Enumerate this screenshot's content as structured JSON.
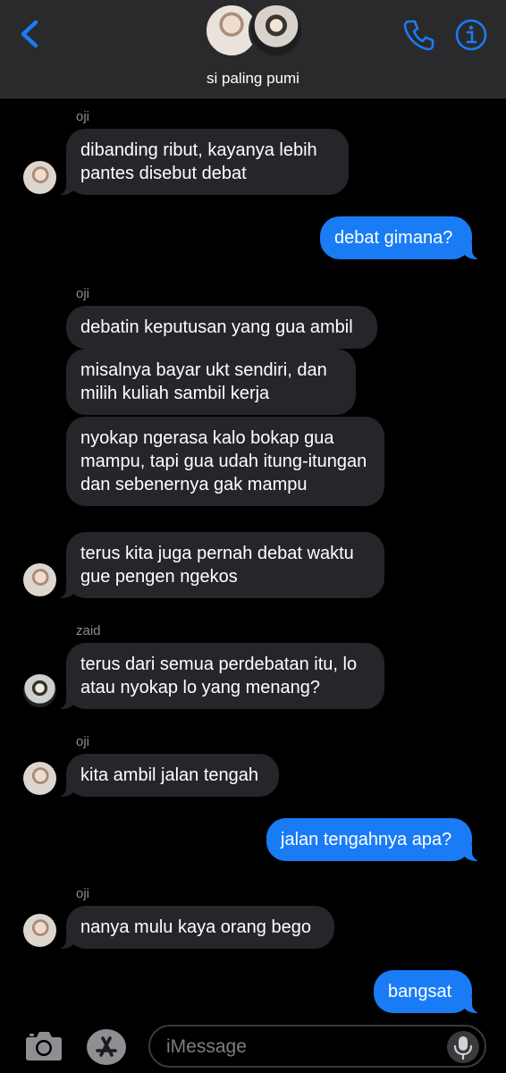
{
  "header": {
    "group_name": "si paling pumi"
  },
  "messages": [
    {
      "sender": "oji",
      "direction": "in",
      "text": "dibanding ribut, kayanya lebih pantes disebut debat"
    },
    {
      "direction": "out",
      "text": "debat gimana?"
    },
    {
      "sender": "oji",
      "direction": "in",
      "text": "debatin keputusan yang gua ambil"
    },
    {
      "direction": "in",
      "text": "misalnya bayar ukt sendiri, dan milih kuliah sambil kerja"
    },
    {
      "direction": "in",
      "text": "nyokap ngerasa kalo bokap gua mampu, tapi gua udah itung-itungan dan sebenernya gak mampu"
    },
    {
      "direction": "in",
      "text": "terus kita juga pernah debat waktu gue pengen ngekos"
    },
    {
      "sender": "zaid",
      "direction": "in",
      "text": "terus dari semua perdebatan itu, lo atau nyokap lo yang menang?"
    },
    {
      "sender": "oji",
      "direction": "in",
      "text": "kita ambil jalan tengah"
    },
    {
      "direction": "out",
      "text": "jalan tengahnya apa?"
    },
    {
      "sender": "oji",
      "direction": "in",
      "text": "nanya mulu kaya orang bego"
    },
    {
      "direction": "out",
      "text": "bangsat"
    }
  ],
  "senders": [
    "oji",
    "oji",
    "zaid",
    "oji",
    "oji"
  ],
  "input": {
    "placeholder": "iMessage"
  },
  "colors": {
    "accent": "#1a7cf5",
    "incoming_bubble": "#26252a",
    "header_bg": "#2a2a2c",
    "background": "#000000"
  },
  "icons": [
    "back-chevron-icon",
    "phone-icon",
    "info-icon",
    "camera-icon",
    "app-store-icon",
    "microphone-icon"
  ]
}
